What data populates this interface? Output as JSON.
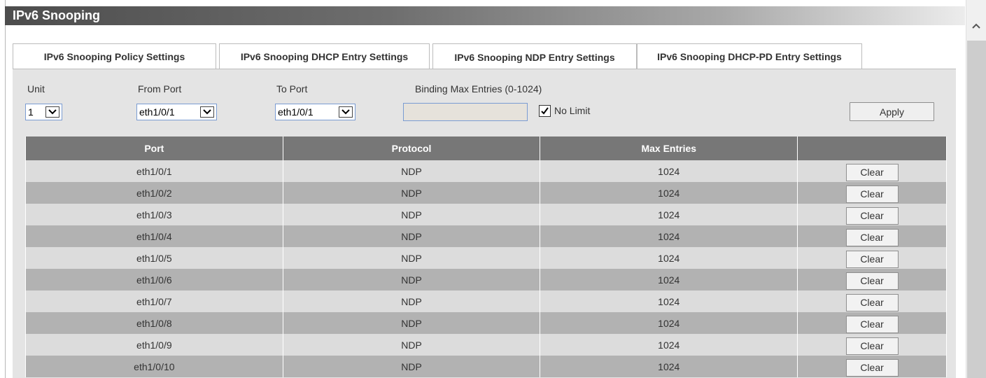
{
  "page": {
    "title": "IPv6 Snooping"
  },
  "tabs": [
    {
      "label": "IPv6 Snooping Policy Settings",
      "active": false
    },
    {
      "label": "IPv6 Snooping DHCP Entry Settings",
      "active": false
    },
    {
      "label": "IPv6 Snooping NDP Entry Settings",
      "active": true
    },
    {
      "label": "IPv6 Snooping DHCP-PD Entry Settings",
      "active": false
    }
  ],
  "form": {
    "unit_label": "Unit",
    "unit_value": "1",
    "from_port_label": "From Port",
    "from_port_value": "eth1/0/1",
    "to_port_label": "To Port",
    "to_port_value": "eth1/0/1",
    "binding_label": "Binding Max Entries (0-1024)",
    "binding_value": "",
    "no_limit_label": "No Limit",
    "no_limit_checked": true,
    "apply_label": "Apply"
  },
  "table": {
    "headers": [
      "Port",
      "Protocol",
      "Max Entries",
      ""
    ],
    "clear_label": "Clear",
    "rows": [
      {
        "port": "eth1/0/1",
        "protocol": "NDP",
        "max_entries": "1024"
      },
      {
        "port": "eth1/0/2",
        "protocol": "NDP",
        "max_entries": "1024"
      },
      {
        "port": "eth1/0/3",
        "protocol": "NDP",
        "max_entries": "1024"
      },
      {
        "port": "eth1/0/4",
        "protocol": "NDP",
        "max_entries": "1024"
      },
      {
        "port": "eth1/0/5",
        "protocol": "NDP",
        "max_entries": "1024"
      },
      {
        "port": "eth1/0/6",
        "protocol": "NDP",
        "max_entries": "1024"
      },
      {
        "port": "eth1/0/7",
        "protocol": "NDP",
        "max_entries": "1024"
      },
      {
        "port": "eth1/0/8",
        "protocol": "NDP",
        "max_entries": "1024"
      },
      {
        "port": "eth1/0/9",
        "protocol": "NDP",
        "max_entries": "1024"
      },
      {
        "port": "eth1/0/10",
        "protocol": "NDP",
        "max_entries": "1024"
      }
    ]
  },
  "icons": {
    "dropdown": "chevron-down-icon",
    "checkbox": "checkmark-icon",
    "scroll_up": "chevron-up-icon"
  },
  "colors": {
    "header_bg": "#777777",
    "row_odd": "#dcdcdc",
    "row_even": "#b2b2b2",
    "panel_bg": "#e4e4e4"
  }
}
